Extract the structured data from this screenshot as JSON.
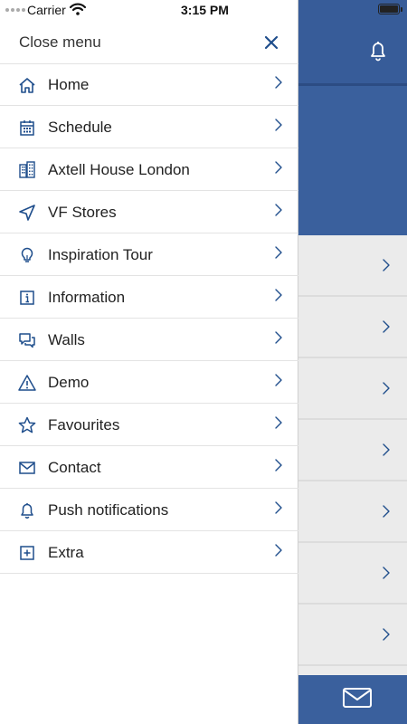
{
  "status_bar": {
    "carrier": "Carrier",
    "time": "3:15 PM"
  },
  "drawer": {
    "close_label": "Close menu",
    "items": [
      {
        "label": "Home",
        "icon": "home-icon"
      },
      {
        "label": "Schedule",
        "icon": "calendar-icon"
      },
      {
        "label": "Axtell House London",
        "icon": "building-icon"
      },
      {
        "label": "VF Stores",
        "icon": "navigation-arrow-icon"
      },
      {
        "label": "Inspiration Tour",
        "icon": "lightbulb-icon"
      },
      {
        "label": "Information",
        "icon": "info-icon"
      },
      {
        "label": "Walls",
        "icon": "chat-bubbles-icon"
      },
      {
        "label": "Demo",
        "icon": "warning-icon"
      },
      {
        "label": "Favourites",
        "icon": "star-icon"
      },
      {
        "label": "Contact",
        "icon": "envelope-icon"
      },
      {
        "label": "Push notifications",
        "icon": "bell-icon"
      },
      {
        "label": "Extra",
        "icon": "plus-square-icon"
      }
    ]
  },
  "background": {
    "header_icon": "bell-icon",
    "footer_icon": "envelope-icon",
    "row_count": 7
  },
  "colors": {
    "accent": "#2f5597",
    "header": "#375c99",
    "icon": "#1f4e8c",
    "panel": "#ebebeb"
  }
}
